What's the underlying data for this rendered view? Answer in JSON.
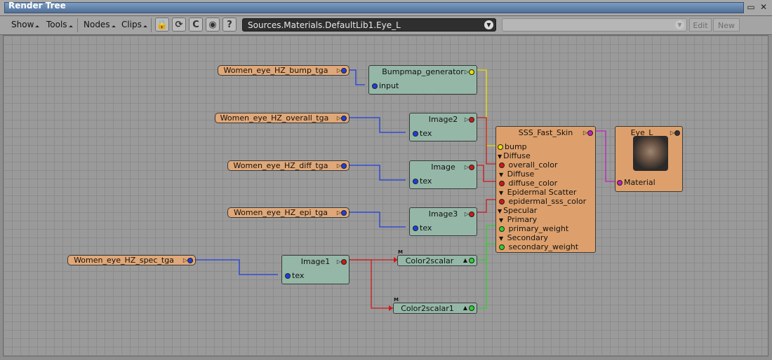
{
  "window": {
    "title": "Render Tree",
    "btn_minimize": "▭",
    "btn_maximize": "?",
    "btn_close": "✕"
  },
  "toolbar": {
    "menus": [
      "Show",
      "Tools",
      "Nodes",
      "Clips"
    ],
    "icons": [
      "lock-icon",
      "refresh-icon",
      "clip-c-icon",
      "apple-icon",
      "help-icon"
    ],
    "icon_glyphs": [
      "🔒",
      "⟳",
      "C",
      "◉",
      "?"
    ],
    "path_value": "Sources.Materials.DefaultLib1.Eye_L",
    "dropdown_glyph": "▼",
    "edit_label": "Edit",
    "new_label": "New"
  },
  "colors": {
    "image_clip": "#e0a878",
    "shader": "#95b7a7",
    "material": "#dda06c",
    "wire_blue": "#1d3fe0",
    "wire_red": "#d01818",
    "wire_yellow": "#e8e000",
    "wire_green": "#2fd02f",
    "wire_magenta": "#c020c0"
  },
  "clips": {
    "bump": "Women_eye_HZ_bump_tga",
    "overall": "Women_eye_HZ_overall_tga",
    "diff": "Women_eye_HZ_diff_tga",
    "epi": "Women_eye_HZ_epi_tga",
    "spec": "Women_eye_HZ_spec_tga",
    "out_glyph": "▷"
  },
  "nodes": {
    "bumpmap": {
      "title": "Bumpmap_generator",
      "input": "input"
    },
    "image2": {
      "title": "Image2",
      "input": "tex"
    },
    "image": {
      "title": "Image",
      "input": "tex"
    },
    "image3": {
      "title": "Image3",
      "input": "tex"
    },
    "image1": {
      "title": "Image1",
      "input": "tex"
    },
    "color2scalar": {
      "title": "Color2scalar",
      "badge": "M"
    },
    "color2scalar1": {
      "title": "Color2scalar1",
      "badge": "M"
    },
    "sss": {
      "title": "SSS_Fast_Skin",
      "ports": {
        "bump": "bump",
        "diffuse": "Diffuse",
        "overall_color": "overall_color",
        "diffuse_sub": "Diffuse",
        "diffuse_color": "diffuse_color",
        "epidermal_scatter": "Epidermal Scatter",
        "epidermal_sss_color": "epidermal_sss_color",
        "specular": "Specular",
        "primary": "Primary",
        "primary_weight": "primary_weight",
        "secondary": "Secondary",
        "secondary_weight": "secondary_weight"
      }
    },
    "eye": {
      "title": "Eye_L",
      "input": "Material"
    }
  }
}
